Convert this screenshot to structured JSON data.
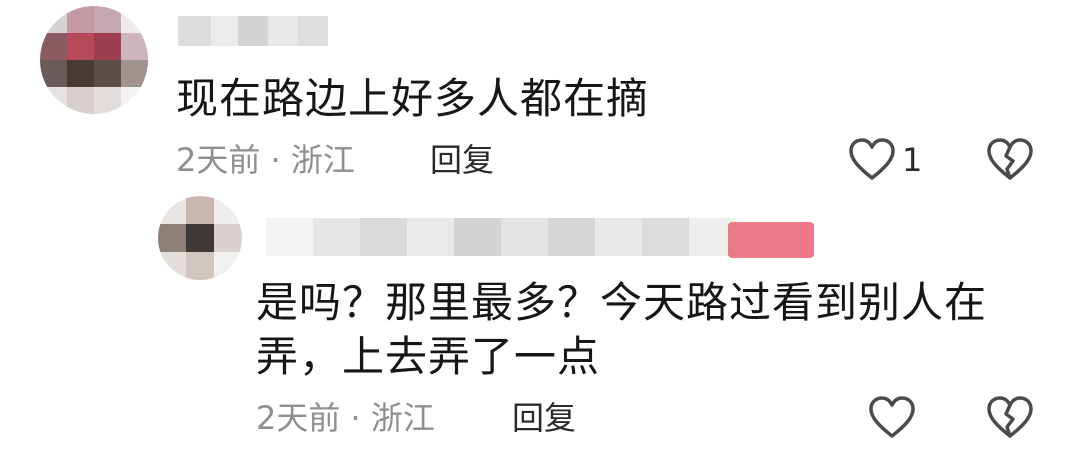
{
  "comments": [
    {
      "text": "现在路边上好多人都在摘",
      "meta": "2天前 · 浙江",
      "reply_label": "回复",
      "like_count": "1",
      "icons": {
        "like": "heart-outline-icon",
        "dislike": "broken-heart-icon"
      }
    },
    {
      "text": "是吗？那里最多？今天路过看到别人在弄，上去弄了一点",
      "meta": "2天前 · 浙江",
      "reply_label": "回复",
      "icons": {
        "like": "heart-outline-icon",
        "dislike": "broken-heart-icon"
      }
    }
  ],
  "colors": {
    "text": "#161616",
    "meta": "#8f8f8f",
    "icon_stroke": "#4a4a4a",
    "badge": "#ec6b7c"
  }
}
